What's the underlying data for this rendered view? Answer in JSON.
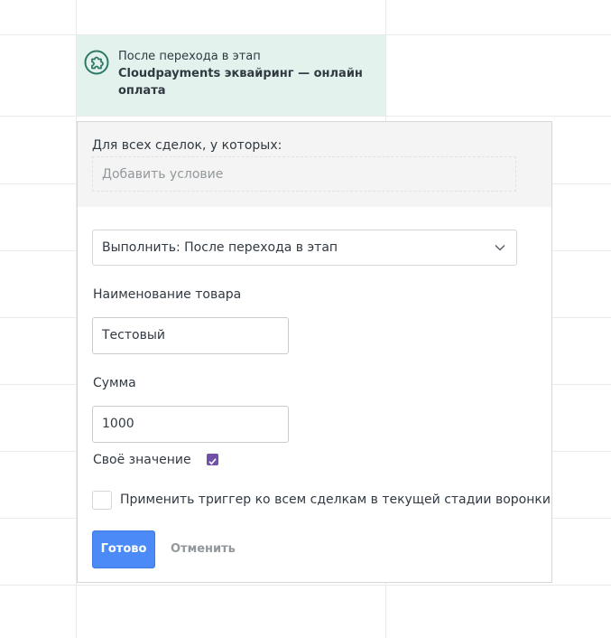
{
  "trigger": {
    "caption": "После перехода в этап",
    "title": "Cloudpayments эквайринг — онлайн оплата",
    "icon": "puzzle-icon",
    "accent_color": "#2d7a67",
    "background_color": "#e3f2ec"
  },
  "popup": {
    "conditions_label": "Для всех сделок, у которых:",
    "add_condition_placeholder": "Добавить условие",
    "execute_select": "Выполнить: После перехода в этап",
    "product_name_label": "Наименование товара",
    "product_name_value": "Тестовый",
    "sum_label": "Сумма",
    "sum_value": "1000",
    "own_value_label": "Своё значение",
    "own_value_checked": true,
    "apply_all_label": "Применить триггер ко всем сделкам в текущей стадии воронки",
    "apply_all_checked": false,
    "done_button": "Готово",
    "cancel_button": "Отменить"
  },
  "colors": {
    "primary_button": "#4c8bf7",
    "checkbox_checked": "#7251a8",
    "cancel_text": "#92989b"
  }
}
